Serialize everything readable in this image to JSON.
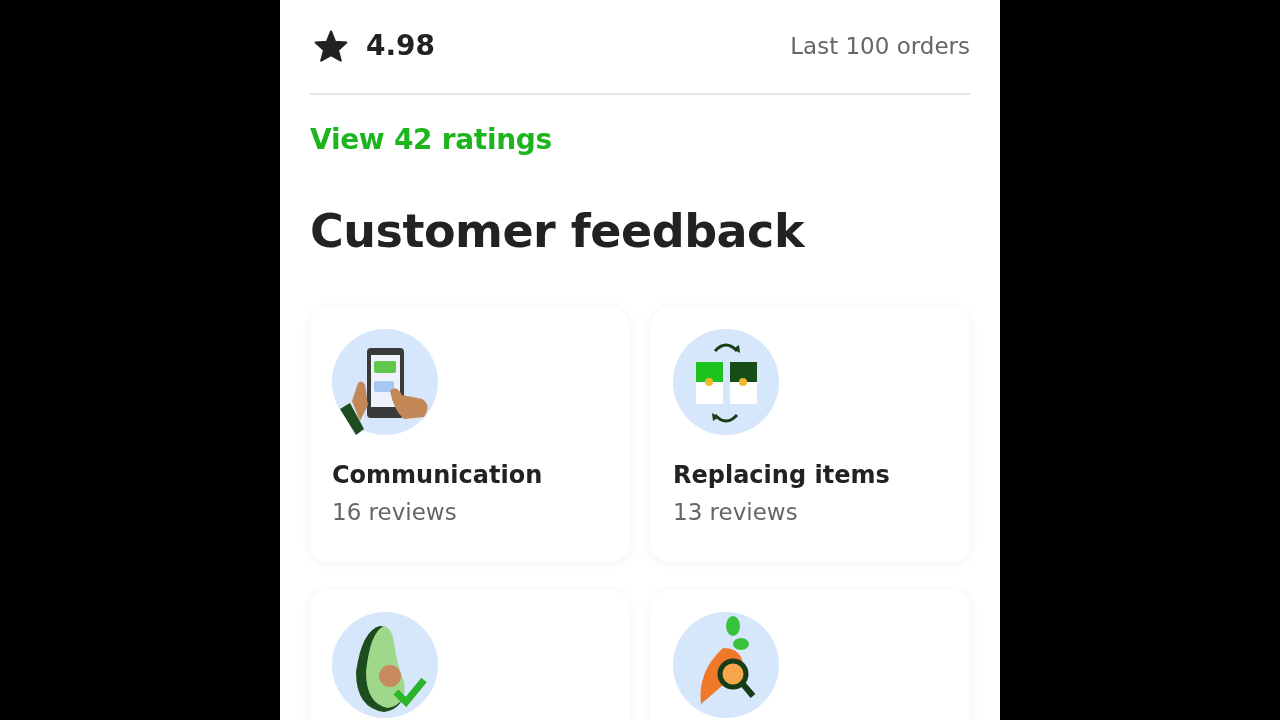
{
  "rating": {
    "value": "4.98",
    "period": "Last 100 orders"
  },
  "ratings_link": "View 42 ratings",
  "section_title": "Customer feedback",
  "cards": [
    {
      "kind": "phone",
      "title": "Communication",
      "reviews": "16 reviews"
    },
    {
      "kind": "swap",
      "title": "Replacing items",
      "reviews": "13 reviews"
    },
    {
      "kind": "avocado"
    },
    {
      "kind": "carrot"
    }
  ]
}
